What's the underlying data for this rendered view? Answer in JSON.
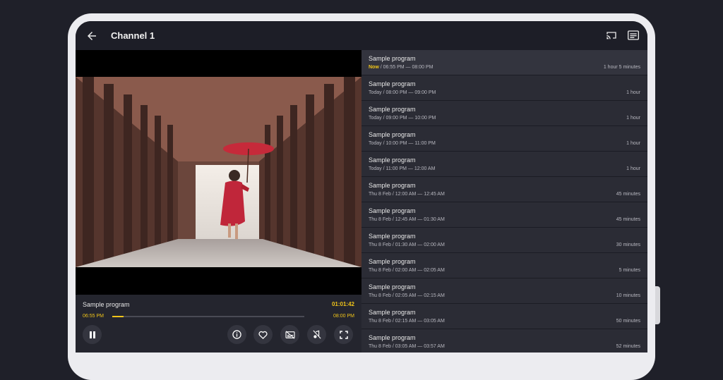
{
  "app": {
    "title": "Channel 1"
  },
  "icons": {
    "back": "arrow-left-icon",
    "cast": "cast-icon",
    "guide": "tv-guide-icon",
    "pause": "pause-icon",
    "info": "info-icon",
    "favorite": "heart-icon",
    "subtitles_off": "subtitles-off-icon",
    "audio_off": "audio-off-icon",
    "fullscreen": "fullscreen-icon"
  },
  "colors": {
    "accent": "#f0c419",
    "background": "#1b1c24",
    "panel": "#2b2c35"
  },
  "player": {
    "program_name": "Sample program",
    "elapsed": "01:01:42",
    "start_time": "06:55 PM",
    "end_time": "08:00 PM",
    "progress_percent": 6
  },
  "epg": {
    "now_label": "Now",
    "items": [
      {
        "name": "Sample program",
        "time": " / 06:55 PM — 08:00 PM",
        "duration": "1 hour 5 minutes",
        "current": true
      },
      {
        "name": "Sample program",
        "time": "Today / 08:00 PM — 09:00 PM",
        "duration": "1 hour"
      },
      {
        "name": "Sample program",
        "time": "Today / 09:00 PM — 10:00 PM",
        "duration": "1 hour"
      },
      {
        "name": "Sample program",
        "time": "Today / 10:00 PM — 11:00 PM",
        "duration": "1 hour"
      },
      {
        "name": "Sample program",
        "time": "Today / 11:00 PM — 12:00 AM",
        "duration": "1 hour"
      },
      {
        "name": "Sample program",
        "time": "Thu 8 Feb / 12:00 AM — 12:45 AM",
        "duration": "45 minutes"
      },
      {
        "name": "Sample program",
        "time": "Thu 8 Feb / 12:45 AM — 01:30 AM",
        "duration": "45 minutes"
      },
      {
        "name": "Sample program",
        "time": "Thu 8 Feb / 01:30 AM — 02:00 AM",
        "duration": "30 minutes"
      },
      {
        "name": "Sample program",
        "time": "Thu 8 Feb / 02:00 AM — 02:05 AM",
        "duration": "5 minutes"
      },
      {
        "name": "Sample program",
        "time": "Thu 8 Feb / 02:05 AM — 02:15 AM",
        "duration": "10 minutes"
      },
      {
        "name": "Sample program",
        "time": "Thu 8 Feb / 02:15 AM — 03:05 AM",
        "duration": "50 minutes"
      },
      {
        "name": "Sample program",
        "time": "Thu 8 Feb / 03:05 AM — 03:57 AM",
        "duration": "52 minutes"
      }
    ]
  }
}
